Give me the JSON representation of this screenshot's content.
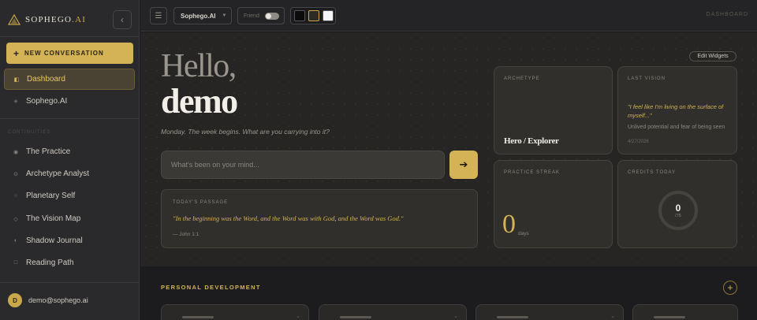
{
  "brand": {
    "name": "SOPHEGO",
    "suffix": ".AI"
  },
  "sidebar": {
    "new_conversation": "NEW CONVERSATION",
    "section_label": "CONTINUITIES",
    "items": [
      {
        "label": "Dashboard",
        "icon": "dashboard-icon",
        "active": true
      },
      {
        "label": "Sophego.AI",
        "icon": "sparkle-icon"
      },
      {
        "label": "The Practice",
        "icon": "sun-icon"
      },
      {
        "label": "Archetype Analyst",
        "icon": "compass-icon"
      },
      {
        "label": "Planetary Self",
        "icon": "circle-icon"
      },
      {
        "label": "The Vision Map",
        "icon": "diamond-icon"
      },
      {
        "label": "Shadow Journal",
        "icon": "moon-icon"
      },
      {
        "label": "Reading Path",
        "icon": "book-icon"
      }
    ],
    "user": {
      "initial": "D",
      "email": "demo@sophego.ai"
    }
  },
  "topbar": {
    "model": "Sophego.AI",
    "friend_label": "Friend",
    "right_label": "DASHBOARD",
    "themes": [
      "#0b0b0c",
      "#2e2b25",
      "#f5f5f5"
    ]
  },
  "main": {
    "greeting": "Hello,",
    "username": "demo",
    "subtitle": "Monday. The week begins. What are you carrying into it?",
    "input_placeholder": "What's been on your mind...",
    "send_icon": "arrow-right-icon",
    "passage": {
      "label": "TODAY'S PASSAGE",
      "quote": "\"In the beginning was the Word, and the Word was with God, and the Word was God.\"",
      "ref": "— John 1:1"
    },
    "edit_widgets": "Edit Widgets"
  },
  "widgets": {
    "archetype": {
      "label": "ARCHETYPE",
      "value": "Hero / Explorer"
    },
    "last_vision": {
      "label": "LAST VISION",
      "quote": "\"I feel like I'm living on the surface of myself...\"",
      "desc": "Unlived potential and fear of being seen",
      "date": "4/27/2026"
    },
    "streak": {
      "label": "PRACTICE STREAK",
      "value": "0",
      "unit": "days"
    },
    "credits": {
      "label": "CREDITS TODAY",
      "value": "0",
      "total": "/75",
      "fraction": 0
    }
  },
  "bottom": {
    "section_label": "PERSONAL DEVELOPMENT"
  },
  "colors": {
    "accent": "#d4b356",
    "background": "#1c1c1f",
    "sidebar": "#2a2a2d"
  }
}
